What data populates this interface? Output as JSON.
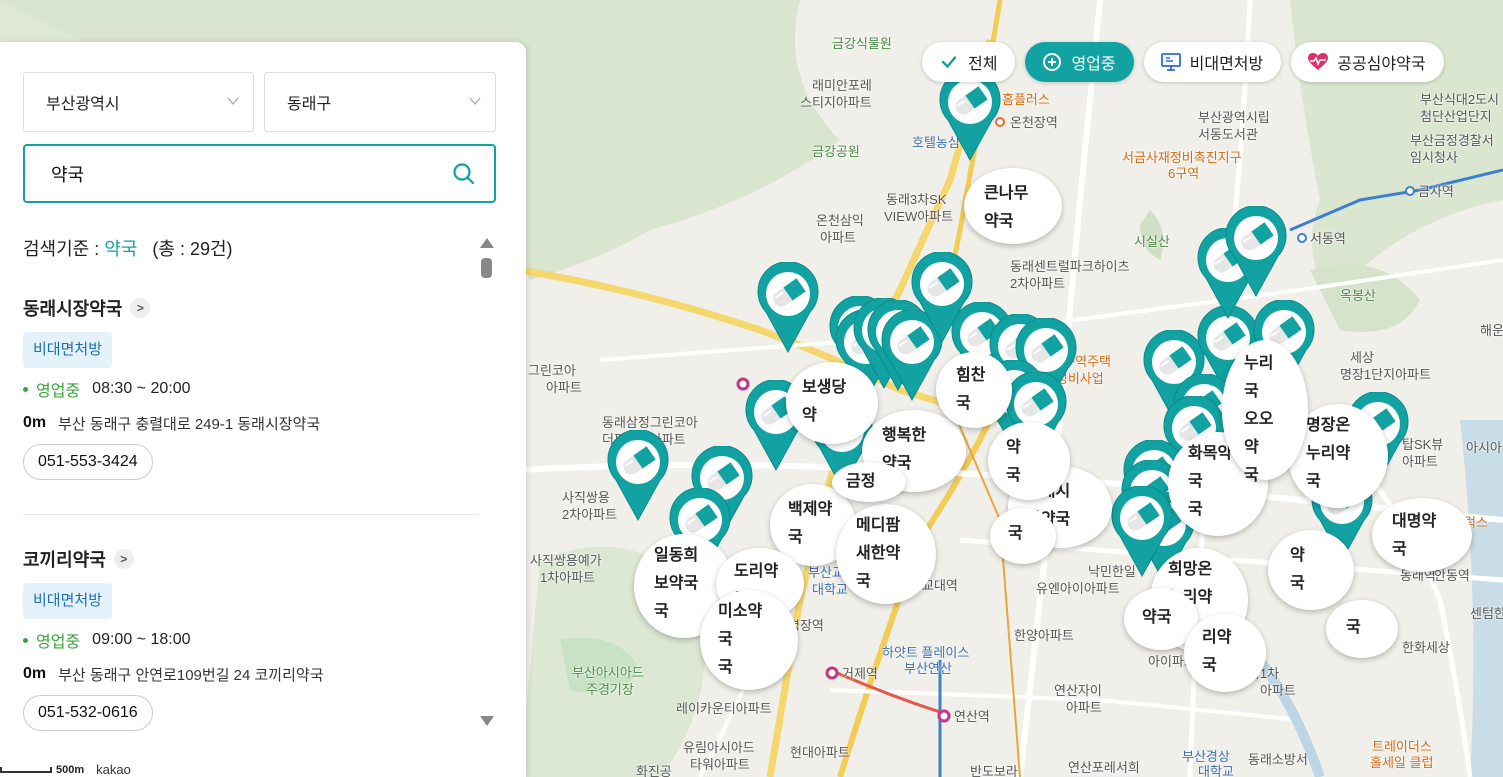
{
  "filters": [
    {
      "label": "전체",
      "active": false,
      "icon": "check-icon"
    },
    {
      "label": "영업중",
      "active": true,
      "icon": "plus-circle-icon"
    },
    {
      "label": "비대면처방",
      "active": false,
      "icon": "monitor-icon"
    },
    {
      "label": "공공심야약국",
      "active": false,
      "icon": "heartbeat-icon"
    }
  ],
  "panel": {
    "city": "부산광역시",
    "district": "동래구",
    "search_value": "약국",
    "criteria_label": "검색기준 :",
    "criteria_keyword": "약국",
    "criteria_total": "(총 : 29건)"
  },
  "results": [
    {
      "name": "동래시장약국",
      "badge": "비대면처방",
      "status": "영업중",
      "hours": "08:30 ~ 20:00",
      "distance": "0m",
      "address": "부산 동래구 충렬대로 249-1 동래시장약국",
      "phone": "051-553-3424"
    },
    {
      "name": "코끼리약국",
      "badge": "비대면처방",
      "status": "영업중",
      "hours": "09:00 ~ 18:00",
      "distance": "0m",
      "address": "부산 동래구 안연로109번길 24 코끼리약국",
      "phone": "051-532-0616"
    }
  ],
  "map": {
    "labels": [
      {
        "text": "금강식물원",
        "cls": "green"
      },
      {
        "text": "래미안포레",
        "cls": ""
      },
      {
        "text": "스티지아파트",
        "cls": ""
      },
      {
        "text": "금강공원",
        "cls": "green"
      },
      {
        "text": "홈플러스",
        "cls": "orange"
      },
      {
        "text": "온천장역",
        "cls": ""
      },
      {
        "text": "호텔농심",
        "cls": "blue"
      },
      {
        "text": "래미안포레스티지아파트",
        "cls": ""
      },
      {
        "text": "부산광역시립",
        "cls": ""
      },
      {
        "text": "서동도서관",
        "cls": ""
      },
      {
        "text": "서금사재정비촉진지구",
        "cls": "orange"
      },
      {
        "text": "6구역",
        "cls": "orange"
      },
      {
        "text": "부산식대2도시",
        "cls": ""
      },
      {
        "text": "첨단산업단지",
        "cls": ""
      },
      {
        "text": "부산금정경찰서",
        "cls": ""
      },
      {
        "text": "임시청사",
        "cls": ""
      },
      {
        "text": "금사역",
        "cls": ""
      },
      {
        "text": "서동역",
        "cls": ""
      },
      {
        "text": "시실산",
        "cls": "green"
      },
      {
        "text": "옥봉산",
        "cls": "green"
      },
      {
        "text": "동래3차SK",
        "cls": ""
      },
      {
        "text": "VIEW아파트",
        "cls": ""
      },
      {
        "text": "온천삼익",
        "cls": ""
      },
      {
        "text": "아파트",
        "cls": ""
      },
      {
        "text": "동래센트럴파크하이츠",
        "cls": ""
      },
      {
        "text": "2차아파트",
        "cls": ""
      },
      {
        "text": "그린코아",
        "cls": ""
      },
      {
        "text": "아파트",
        "cls": ""
      },
      {
        "text": "동래삼정그린코아",
        "cls": ""
      },
      {
        "text": "더퍼스트아파트",
        "cls": ""
      },
      {
        "text": "사직쌍용",
        "cls": ""
      },
      {
        "text": "2차아파트",
        "cls": ""
      },
      {
        "text": "사직쌍용예가",
        "cls": ""
      },
      {
        "text": "1차아파트",
        "cls": ""
      },
      {
        "text": "부산아시아드",
        "cls": "green"
      },
      {
        "text": "주경기장",
        "cls": "green"
      },
      {
        "text": "레이카운티아파트",
        "cls": ""
      },
      {
        "text": "유림아시아드",
        "cls": ""
      },
      {
        "text": "타워아파트",
        "cls": ""
      },
      {
        "text": "현대아파트",
        "cls": ""
      },
      {
        "text": "거제역",
        "cls": ""
      },
      {
        "text": "연산역",
        "cls": ""
      },
      {
        "text": "하얏트 플레이스",
        "cls": "blue"
      },
      {
        "text": "부산연산",
        "cls": "blue"
      },
      {
        "text": "한양아파트",
        "cls": ""
      },
      {
        "text": "연산자이",
        "cls": ""
      },
      {
        "text": "아파트",
        "cls": ""
      },
      {
        "text": "낙민한일",
        "cls": ""
      },
      {
        "text": "유엔아이아파트",
        "cls": ""
      },
      {
        "text": "교대역",
        "cls": ""
      },
      {
        "text": "부산경상",
        "cls": "blue"
      },
      {
        "text": "대학교",
        "cls": "blue"
      },
      {
        "text": "동래소방서",
        "cls": ""
      },
      {
        "text": "트레이더스",
        "cls": "orange"
      },
      {
        "text": "홀세일 클럽",
        "cls": "orange"
      },
      {
        "text": "센텀한",
        "cls": ""
      },
      {
        "text": "한화세상",
        "cls": ""
      },
      {
        "text": "안동역",
        "cls": ""
      },
      {
        "text": "아시아",
        "cls": ""
      },
      {
        "text": "1단지아파트",
        "cls": ""
      },
      {
        "text": "해운",
        "cls": ""
      },
      {
        "text": "1차아파트",
        "cls": ""
      },
      {
        "text": "명장1단지아파트",
        "cls": ""
      },
      {
        "text": "세상",
        "cls": ""
      },
      {
        "text": "탑SK뷰",
        "cls": ""
      },
      {
        "text": "아파트",
        "cls": ""
      },
      {
        "text": "온천1구역주택",
        "cls": "orange"
      },
      {
        "text": "재개발정비사업",
        "cls": "orange"
      },
      {
        "text": "반도보라",
        "cls": ""
      },
      {
        "text": "연산포레서희",
        "cls": ""
      },
      {
        "text": "안락1차",
        "cls": ""
      },
      {
        "text": "아파트",
        "cls": ""
      },
      {
        "text": "부산교",
        "cls": "blue"
      },
      {
        "text": "대학교",
        "cls": "blue"
      },
      {
        "text": "센텀티원",
        "cls": ""
      },
      {
        "text": "동래역",
        "cls": ""
      },
      {
        "text": "럭스",
        "cls": "orange"
      },
      {
        "text": "아이파크",
        "cls": ""
      },
      {
        "text": "명장역",
        "cls": ""
      },
      {
        "text": "화진공",
        "cls": ""
      }
    ],
    "bubbles": [
      {
        "text": "큰나무\n약국"
      },
      {
        "text": "보생당\n약"
      },
      {
        "text": "행복한\n약국"
      },
      {
        "text": "힘찬\n국"
      },
      {
        "text": "동래시\n장약국"
      },
      {
        "text": "백제약\n국"
      },
      {
        "text": "메디팜\n새한약\n국"
      },
      {
        "text": "일동희\n보약국\n국"
      },
      {
        "text": "도리약\n국"
      },
      {
        "text": "미소약\n국\n국"
      },
      {
        "text": "화목약\n국\n국"
      },
      {
        "text": "희망온\n누리약\n국"
      },
      {
        "text": "명장온\n누리약\n국"
      },
      {
        "text": "대명약\n국"
      },
      {
        "text": "누리\n국\n오오약\n국"
      },
      {
        "text": "약\n국"
      },
      {
        "text": "약\n국"
      },
      {
        "text": "약국"
      },
      {
        "text": "국"
      },
      {
        "text": "국"
      },
      {
        "text": "리약\n국"
      },
      {
        "text": "금정"
      }
    ],
    "scale": "500m",
    "logo": "kakao"
  }
}
